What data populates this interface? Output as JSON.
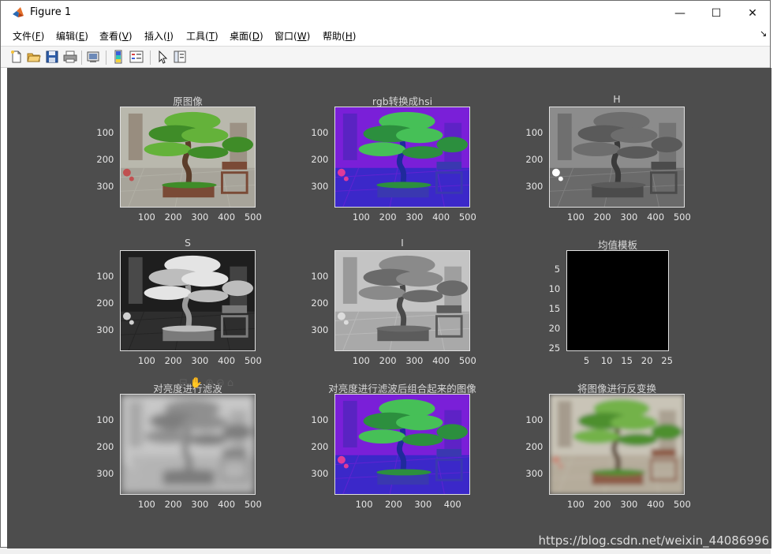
{
  "window": {
    "title": "Figure 1",
    "controls": {
      "minimize": "—",
      "maximize": "☐",
      "close": "✕"
    }
  },
  "menu": {
    "items": [
      {
        "label": "文件",
        "key": "F"
      },
      {
        "label": "编辑",
        "key": "E"
      },
      {
        "label": "查看",
        "key": "V"
      },
      {
        "label": "插入",
        "key": "I"
      },
      {
        "label": "工具",
        "key": "T"
      },
      {
        "label": "桌面",
        "key": "D"
      },
      {
        "label": "窗口",
        "key": "W"
      },
      {
        "label": "帮助",
        "key": "H"
      }
    ],
    "overflow": "↘"
  },
  "toolbar": {
    "icons": [
      "new-figure-icon",
      "open-file-icon",
      "save-icon",
      "print-icon",
      "link-plot-icon",
      "insert-colorbar-icon",
      "insert-legend-icon",
      "edit-plot-icon",
      "plot-browser-icon"
    ]
  },
  "figure": {
    "background": "#4d4d4d",
    "subplots": [
      {
        "title": "原图像",
        "xticks": [
          "100",
          "200",
          "300",
          "400",
          "500"
        ],
        "yticks": [
          "100",
          "200",
          "300"
        ],
        "style": "original"
      },
      {
        "title": "rgb转换成hsi",
        "xticks": [
          "100",
          "200",
          "300",
          "400",
          "500"
        ],
        "yticks": [
          "100",
          "200",
          "300"
        ],
        "style": "hsi"
      },
      {
        "title": "H",
        "xticks": [
          "100",
          "200",
          "300",
          "400",
          "500"
        ],
        "yticks": [
          "100",
          "200",
          "300"
        ],
        "style": "hue"
      },
      {
        "title": "S",
        "xticks": [
          "100",
          "200",
          "300",
          "400",
          "500"
        ],
        "yticks": [
          "100",
          "200",
          "300"
        ],
        "style": "sat"
      },
      {
        "title": "I",
        "xticks": [
          "100",
          "200",
          "300",
          "400",
          "500"
        ],
        "yticks": [
          "100",
          "200",
          "300"
        ],
        "style": "intensity"
      },
      {
        "title": "均值模板",
        "xticks": [
          "5",
          "10",
          "15",
          "20",
          "25"
        ],
        "yticks": [
          "5",
          "10",
          "15",
          "20",
          "25"
        ],
        "style": "black"
      },
      {
        "title": "对亮度进行滤波",
        "xticks": [
          "100",
          "200",
          "300",
          "400",
          "500"
        ],
        "yticks": [
          "100",
          "200",
          "300"
        ],
        "style": "blur"
      },
      {
        "title": "对亮度进行滤波后组合起来的图像",
        "xticks": [
          "100",
          "200",
          "300",
          "400"
        ],
        "yticks": [
          "100",
          "200",
          "300"
        ],
        "style": "hsi"
      },
      {
        "title": "将图像进行反变换",
        "xticks": [
          "100",
          "200",
          "300",
          "400",
          "500"
        ],
        "yticks": [
          "100",
          "200",
          "300"
        ],
        "style": "blurcolor"
      }
    ],
    "figure_toolbar_glyphs": "⊟✋⊕⊖⌂"
  },
  "watermark": "https://blog.csdn.net/weixin_44086996"
}
